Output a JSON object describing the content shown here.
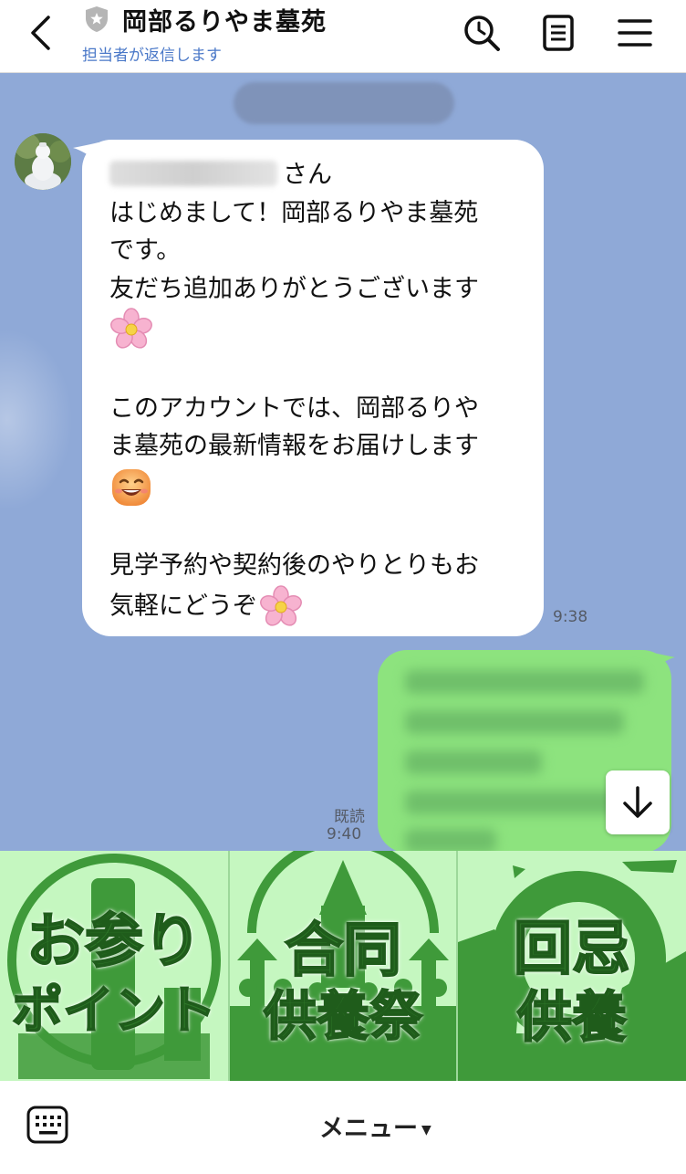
{
  "header": {
    "title": "岡部るりやま墓苑",
    "subtitle": "担当者が返信します"
  },
  "chat": {
    "incoming": {
      "name_suffix": "さん",
      "lines": [
        "はじめまして！岡部るりやま墓苑",
        "です。",
        "友だち追加ありがとうございます",
        "このアカウントでは、岡部るりや",
        "ま墓苑の最新情報をお届けします",
        "見学予約や契約後のやりとりもお",
        "気軽にどうぞ"
      ],
      "time": "9:38"
    },
    "outgoing": {
      "read_label": "既読",
      "time": "9:40"
    }
  },
  "rich_menu": {
    "tiles": [
      {
        "line1": "お参り",
        "line2": "ポイント"
      },
      {
        "line1": "合同",
        "line2": "供養祭"
      },
      {
        "line1": "回忌",
        "line2": "供養"
      }
    ]
  },
  "bottom_bar": {
    "menu_label": "メニュー",
    "menu_arrow": "▼"
  },
  "colors": {
    "chat_background": "#8fa9d7",
    "outgoing_bubble": "#8de37e",
    "rich_menu_green": "#2f7a2a",
    "subtitle_blue": "#4a78c8"
  },
  "icons": [
    "back-chevron-icon",
    "shield-star-icon",
    "search-icon",
    "notes-icon",
    "hamburger-menu-icon",
    "scroll-down-arrow-icon",
    "keyboard-icon",
    "cherry-blossom-icon",
    "smiling-face-icon"
  ]
}
